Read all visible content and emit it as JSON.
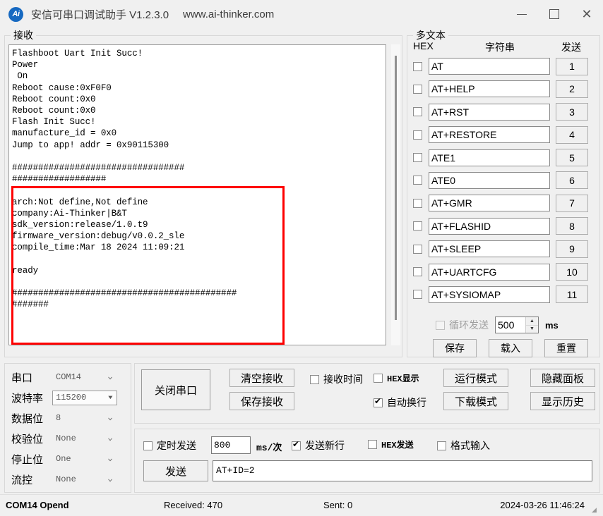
{
  "titlebar": {
    "icon": "app-logo-icon",
    "title": "安信可串口调试助手 V1.2.3.0",
    "url": "www.ai-thinker.com",
    "minimize": "minimize-icon",
    "maximize": "maximize-icon",
    "close": "close-icon"
  },
  "receive": {
    "group_label": "接收",
    "text": "Flashboot Uart Init Succ!\nPower\n On\nReboot cause:0xF0F0\nReboot count:0x0\nReboot count:0x0\nFlash Init Succ!\nmanufacture_id = 0x0\nJump to app! addr = 0x90115300\n\n#################################\n##################\n\narch:Not define,Not define\ncompany:Ai-Thinker|B&T\nsdk_version:release/1.0.t9\nfirmware_version:debug/v0.0.2_sle\ncompile_time:Mar 18 2024 11:09:21\n\nready\n\n###########################################\n#######"
  },
  "multitext": {
    "group_label": "多文本",
    "hex_header": "HEX",
    "string_header": "字符串",
    "send_header": "发送",
    "rows": [
      {
        "hex_checked": false,
        "command": "AT",
        "send_label": "1"
      },
      {
        "hex_checked": false,
        "command": "AT+HELP",
        "send_label": "2"
      },
      {
        "hex_checked": false,
        "command": "AT+RST",
        "send_label": "3"
      },
      {
        "hex_checked": false,
        "command": "AT+RESTORE",
        "send_label": "4"
      },
      {
        "hex_checked": false,
        "command": "ATE1",
        "send_label": "5"
      },
      {
        "hex_checked": false,
        "command": "ATE0",
        "send_label": "6"
      },
      {
        "hex_checked": false,
        "command": "AT+GMR",
        "send_label": "7"
      },
      {
        "hex_checked": false,
        "command": "AT+FLASHID",
        "send_label": "8"
      },
      {
        "hex_checked": false,
        "command": "AT+SLEEP",
        "send_label": "9"
      },
      {
        "hex_checked": false,
        "command": "AT+UARTCFG",
        "send_label": "10"
      },
      {
        "hex_checked": false,
        "command": "AT+SYSIOMAP",
        "send_label": "11"
      }
    ],
    "loop_label": "循环发送",
    "loop_checked": false,
    "loop_interval": "500",
    "loop_unit": "ms",
    "save_label": "保存",
    "load_label": "载入",
    "reset_label": "重置"
  },
  "serial": {
    "rows": [
      {
        "label": "串口",
        "value": "COM14",
        "focused": false
      },
      {
        "label": "波特率",
        "value": "115200",
        "focused": true
      },
      {
        "label": "数据位",
        "value": "8",
        "focused": false
      },
      {
        "label": "校验位",
        "value": "None",
        "focused": false
      },
      {
        "label": "停止位",
        "value": "One",
        "focused": false
      },
      {
        "label": "流控",
        "value": "None",
        "focused": false
      }
    ]
  },
  "controls": {
    "open_close_label": "关闭串口",
    "clear_recv_label": "清空接收",
    "save_recv_label": "保存接收",
    "run_mode_label": "运行模式",
    "download_mode_label": "下载模式",
    "hide_panel_label": "隐藏面板",
    "show_history_label": "显示历史",
    "recv_time_label": "接收时间",
    "recv_time_checked": false,
    "hex_display_label": "HEX显示",
    "hex_display_checked": false,
    "auto_wrap_label": "自动换行",
    "auto_wrap_checked": true
  },
  "send": {
    "timed_label": "定时发送",
    "timed_checked": false,
    "interval": "800",
    "interval_unit": "ms/次",
    "newline_label": "发送新行",
    "newline_checked": true,
    "hex_send_label": "HEX发送",
    "hex_send_checked": false,
    "format_input_label": "格式输入",
    "format_input_checked": false,
    "send_button_label": "发送",
    "input_value": "AT+ID=2"
  },
  "statusbar": {
    "connection": "COM14 Opend",
    "received": "Received: 470",
    "sent": "Sent: 0",
    "datetime": "2024-03-26 11:46:24"
  }
}
